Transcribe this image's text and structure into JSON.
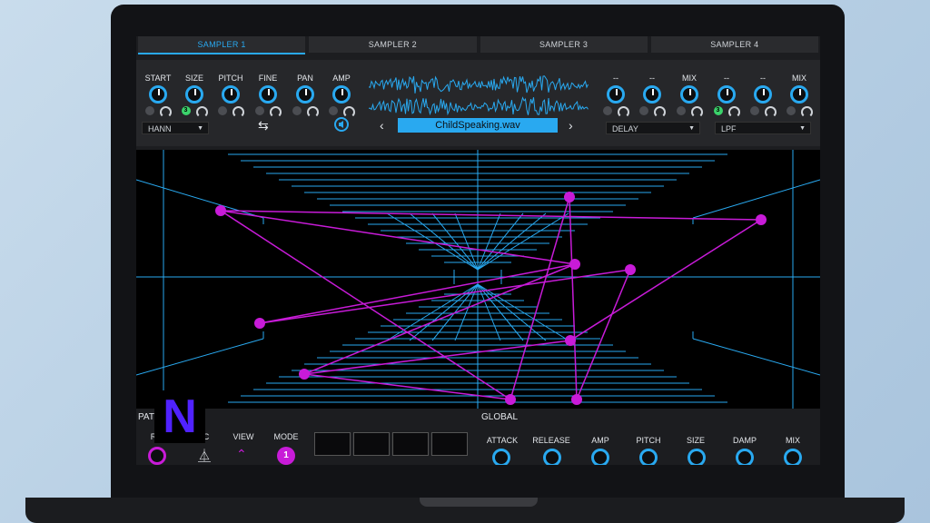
{
  "tabs": [
    "SAMPLER 1",
    "SAMPLER 2",
    "SAMPLER 3",
    "SAMPLER 4"
  ],
  "active_tab": 0,
  "sampler": {
    "left_knobs": [
      "START",
      "SIZE",
      "PITCH",
      "FINE",
      "PAN",
      "AMP"
    ],
    "right_knobs": [
      "--",
      "--",
      "MIX",
      "--",
      "--",
      "MIX"
    ],
    "size_badge": "3",
    "mix_badge": "3",
    "window_select": "HANN",
    "file_name": "ChildSpeaking.wav",
    "prev_arrow": "‹",
    "next_arrow": "›",
    "effect1_select": "DELAY",
    "effect2_select": "LPF"
  },
  "pattern": {
    "title": "PAT",
    "labels": [
      "R",
      "C",
      "VIEW",
      "MODE"
    ],
    "mode_value": "1"
  },
  "global": {
    "title": "GLOBAL",
    "knobs": [
      "ATTACK",
      "RELEASE",
      "AMP",
      "PITCH",
      "SIZE",
      "DAMP",
      "MIX"
    ]
  },
  "logo_text": "N",
  "colors": {
    "accent_blue": "#29a9f0",
    "accent_purple": "#c81bd8",
    "logo_blue": "#5022ff"
  },
  "icons": {
    "swap": "swap-arrows-icon",
    "sound": "speaker-icon",
    "view": "chevron-up-icon",
    "music": "metronome-icon"
  }
}
